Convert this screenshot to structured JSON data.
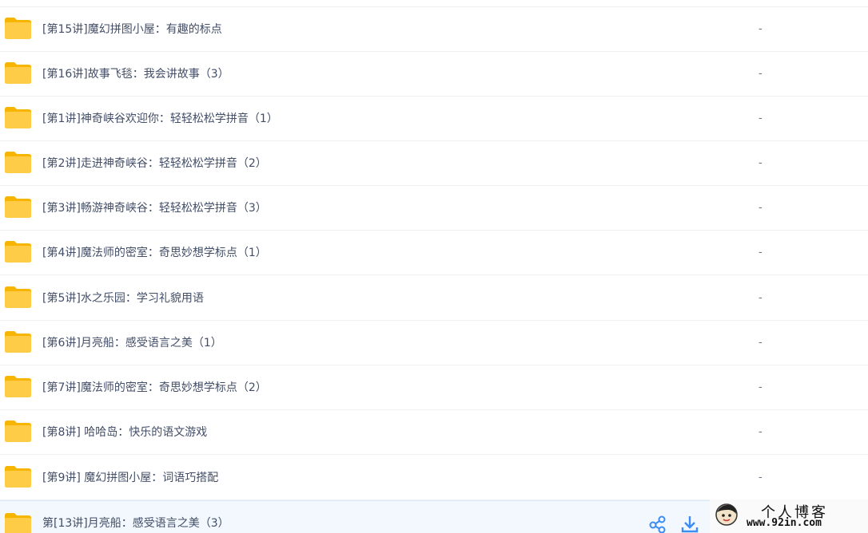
{
  "file_list": {
    "rows": [
      {
        "name": "[第15讲]魔幻拼图小屋：有趣的标点",
        "size": "-"
      },
      {
        "name": "[第16讲]故事飞毯：我会讲故事（3）",
        "size": "-"
      },
      {
        "name": "[第1讲]神奇峡谷欢迎你：轻轻松松学拼音（1）",
        "size": "-"
      },
      {
        "name": "[第2讲]走进神奇峡谷：轻轻松松学拼音（2）",
        "size": "-"
      },
      {
        "name": "[第3讲]畅游神奇峡谷：轻轻松松学拼音（3）",
        "size": "-"
      },
      {
        "name": "[第4讲]魔法师的密室：奇思妙想学标点（1）",
        "size": "-"
      },
      {
        "name": "[第5讲]水之乐园：学习礼貌用语",
        "size": "-"
      },
      {
        "name": "[第6讲]月亮船：感受语言之美（1）",
        "size": "-"
      },
      {
        "name": "[第7讲]魔法师的密室：奇思妙想学标点（2）",
        "size": "-"
      },
      {
        "name": "[第8讲] 哈哈岛：快乐的语文游戏",
        "size": "-"
      },
      {
        "name": "[第9讲] 魔幻拼图小屋：词语巧搭配",
        "size": "-"
      },
      {
        "name": "第[13讲]月亮船：感受语言之美（3）",
        "size": ""
      }
    ],
    "hover_row_index": 11,
    "icons": {
      "folder": "folder-icon",
      "share": "share-icon",
      "download": "download-icon"
    },
    "colors": {
      "folder": "#ffc93d",
      "action_blue": "#3b8cf5",
      "hover_bg": "#f2f8fe"
    }
  },
  "watermark": {
    "title": "个人博客",
    "url": "www.92in.com"
  }
}
